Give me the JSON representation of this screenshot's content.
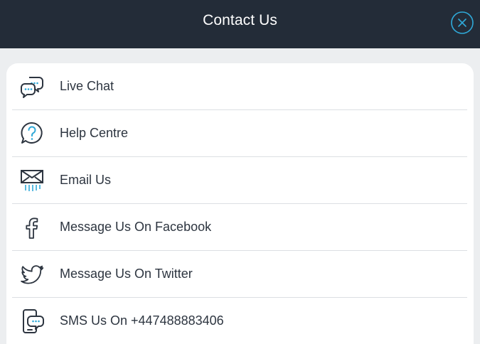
{
  "header": {
    "title": "Contact Us"
  },
  "colors": {
    "header_bg": "#232c38",
    "accent": "#2fa9d8",
    "icon_dark": "#2d3540",
    "divider": "#dcdfe3"
  },
  "contact_options": [
    {
      "label": "Live Chat",
      "icon": "chat-bubbles-icon"
    },
    {
      "label": "Help Centre",
      "icon": "question-bubble-icon"
    },
    {
      "label": "Email Us",
      "icon": "envelope-icon"
    },
    {
      "label": "Message Us On Facebook",
      "icon": "facebook-icon"
    },
    {
      "label": "Message Us On Twitter",
      "icon": "twitter-icon"
    },
    {
      "label": "SMS Us On +447488883406",
      "icon": "phone-sms-icon"
    }
  ]
}
